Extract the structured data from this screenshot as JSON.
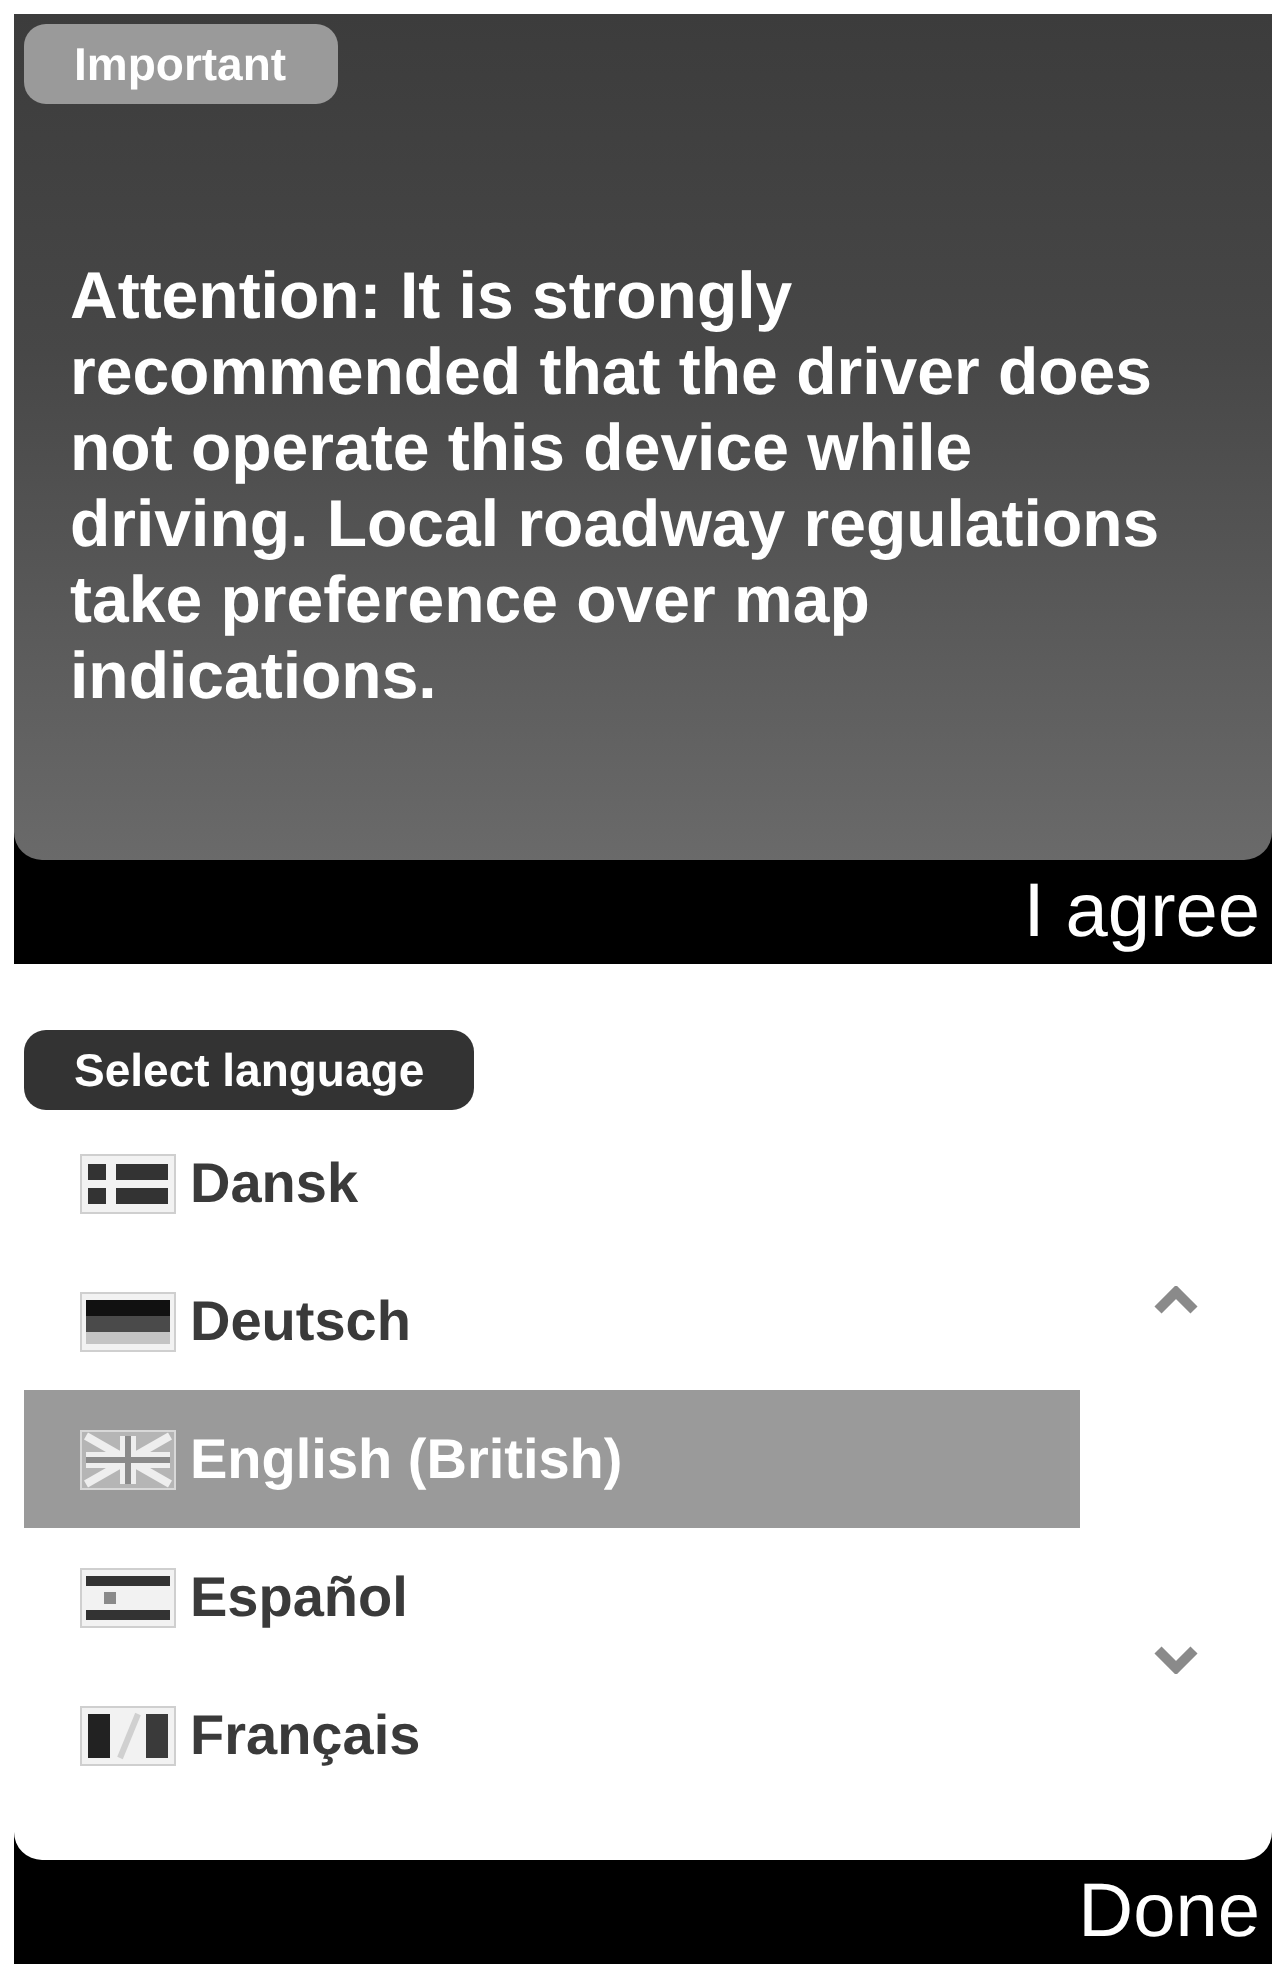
{
  "warning": {
    "badge": "Important",
    "message": "Attention: It is strongly recommended that the driver does not operate this device while driving. Local roadway regulations take preference over map indications.",
    "button": "I agree"
  },
  "language_picker": {
    "title": "Select language",
    "languages": [
      {
        "name": "Dansk",
        "kind": "dk",
        "selected": false
      },
      {
        "name": "Deutsch",
        "kind": "de",
        "selected": false
      },
      {
        "name": "English (British)",
        "kind": "gb",
        "selected": true
      },
      {
        "name": "Español",
        "kind": "es",
        "selected": false
      },
      {
        "name": "Français",
        "kind": "fr",
        "selected": false
      }
    ],
    "button": "Done"
  }
}
